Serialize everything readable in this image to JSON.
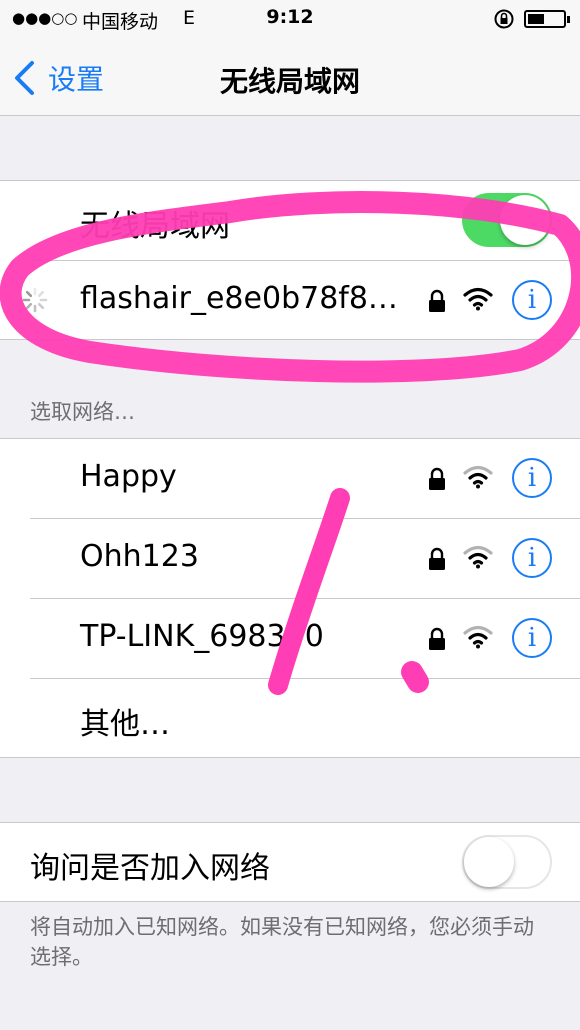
{
  "status_bar": {
    "signal": "●●●○○",
    "carrier": "中国移动",
    "network": "E",
    "time": "9:12"
  },
  "nav": {
    "back_label": "设置",
    "title": "无线局域网"
  },
  "wifi_toggle": {
    "label": "无线局域网",
    "on": true
  },
  "connected_network": {
    "name": "flashair_e8e0b78f8…",
    "locked": true
  },
  "choose_network_header": "选取网络…",
  "networks": [
    {
      "name": "Happy",
      "locked": true
    },
    {
      "name": "Ohh123",
      "locked": true
    },
    {
      "name": "TP-LINK_698390",
      "locked": true
    }
  ],
  "other_label": "其他…",
  "ask_join": {
    "label": "询问是否加入网络",
    "on": false
  },
  "footer": "将自动加入已知网络。如果没有已知网络，您必须手动选择。",
  "info_glyph": "i",
  "colors": {
    "accent": "#1a7cf5",
    "toggle_on": "#4cd964",
    "annotation": "#ff3db4"
  },
  "annotation_marks": [
    "1",
    "."
  ]
}
